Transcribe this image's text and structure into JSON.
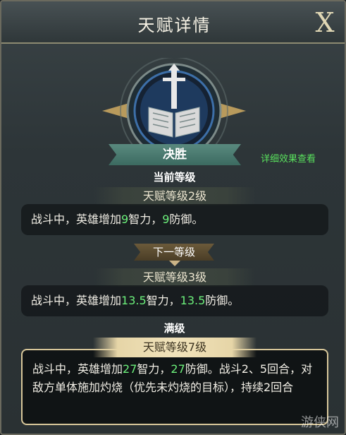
{
  "header": {
    "title": "天赋详情",
    "close_label": "X"
  },
  "talent": {
    "name": "决胜",
    "detail_link": "详细效果查看"
  },
  "current": {
    "section_label": "当前等级",
    "level_label": "天赋等级2级",
    "desc_prefix": "战斗中，英雄增加",
    "value_a": "9",
    "mid": "智力，",
    "value_b": "9",
    "desc_suffix": "防御。"
  },
  "next": {
    "section_label": "下一等级",
    "level_label": "天赋等级3级",
    "desc_prefix": "战斗中，英雄增加",
    "value_a": "13.5",
    "mid": "智力，",
    "value_b": "13.5",
    "desc_suffix": "防御。"
  },
  "max": {
    "section_label": "满级",
    "level_label": "天赋等级7级",
    "desc_prefix": "战斗中，英雄增加",
    "value_a": "27",
    "mid": "智力，",
    "value_b": "27",
    "desc_suffix": "防御。战斗2、5回合，对敌方单体施加灼烧（优先未灼烧的目标），持续2回合"
  },
  "watermark": "游侠网",
  "colors": {
    "highlight_number": "#6cf07b",
    "link": "#59e05d",
    "banner": "#4a7a6f",
    "gold": "#d8c79a"
  },
  "icons": {
    "talent_emblem": "book-sword-icon"
  }
}
